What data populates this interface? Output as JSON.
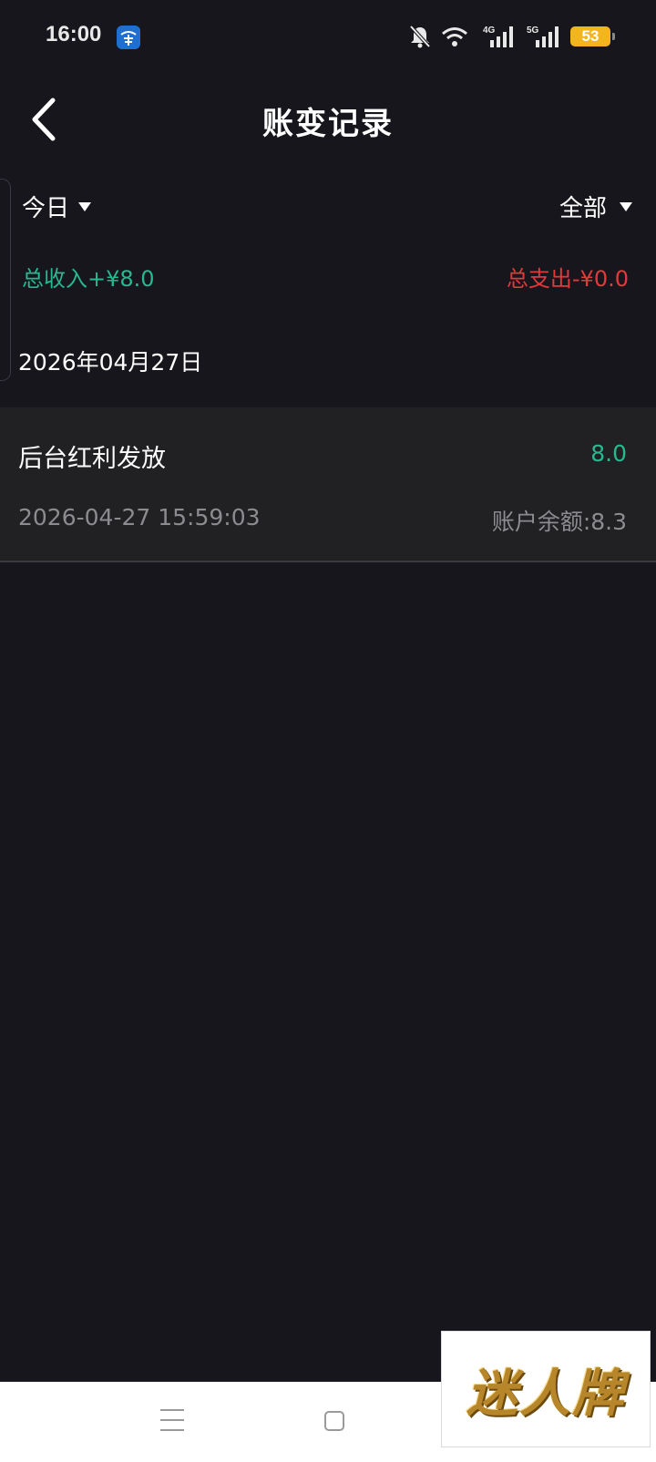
{
  "status_bar": {
    "time": "16:00",
    "battery": "53",
    "icons": [
      "app-notification-icon",
      "bell-muted-icon",
      "wifi-icon",
      "signal-4g-icon",
      "signal-5g-icon",
      "battery-icon"
    ],
    "network_4g": "4G",
    "network_5g": "5G"
  },
  "header": {
    "title": "账变记录",
    "back_icon": "chevron-left-icon"
  },
  "filters": {
    "period": "今日",
    "category": "全部"
  },
  "summary": {
    "total_income": "总收入+¥8.0",
    "total_expense": "总支出-¥0.0"
  },
  "date_group": "2026年04月27日",
  "records": [
    {
      "title": "后台红利发放",
      "amount": "8.0",
      "time": "2026-04-27 15:59:03",
      "balance": "账户余额:8.3"
    }
  ],
  "watermark": "迷人牌",
  "colors": {
    "background": "#17161c",
    "card": "#212124",
    "income": "#26b88f",
    "expense": "#e2393b",
    "muted": "#8c8c90",
    "battery": "#f2b51d"
  }
}
